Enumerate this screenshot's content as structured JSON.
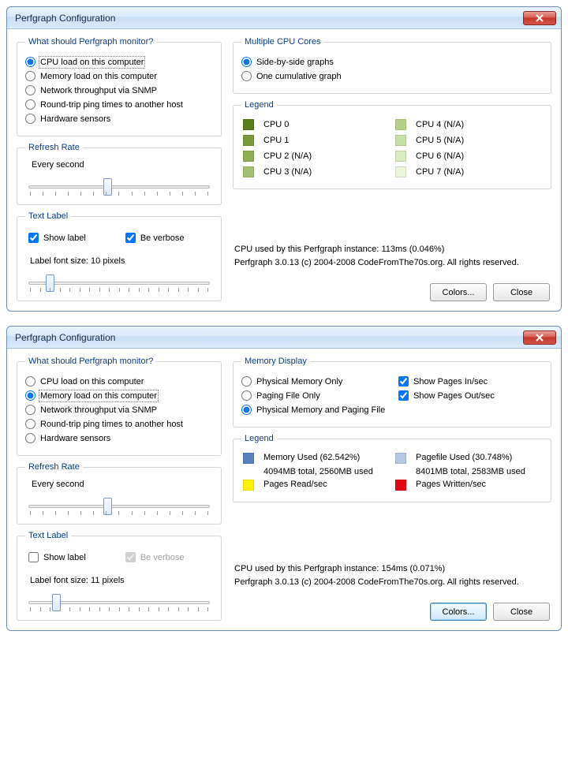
{
  "win1": {
    "title": "Perfgraph Configuration",
    "monitor": {
      "legend": "What should Perfgraph monitor?",
      "opt_cpu": "CPU load on this computer",
      "opt_mem": "Memory load on this computer",
      "opt_net": "Network throughput via SNMP",
      "opt_ping": "Round-trip ping times to another host",
      "opt_hw": "Hardware sensors"
    },
    "refresh": {
      "legend": "Refresh Rate",
      "label": "Every second"
    },
    "textlabel": {
      "legend": "Text Label",
      "show": "Show label",
      "verbose": "Be verbose",
      "font": "Label font size: 10 pixels"
    },
    "cores": {
      "legend": "Multiple CPU Cores",
      "side": "Side-by-side graphs",
      "cumulative": "One cumulative graph"
    },
    "cpu_legend": {
      "legend": "Legend",
      "c0": "CPU 0",
      "c1": "CPU 1",
      "c2": "CPU 2 (N/A)",
      "c3": "CPU 3 (N/A)",
      "c4": "CPU 4 (N/A)",
      "c5": "CPU 5 (N/A)",
      "c6": "CPU 6 (N/A)",
      "c7": "CPU 7 (N/A)",
      "col0": "#5b7c1a",
      "col1": "#7a9a3a",
      "col2": "#8fae54",
      "col3": "#a3c06f",
      "col4": "#b6d08a",
      "col5": "#c8dfa5",
      "col6": "#d9ebc1",
      "col7": "#eaf5dc"
    },
    "status1": "CPU used by this Perfgraph instance: 113ms (0.046%)",
    "status2": "Perfgraph 3.0.13 (c) 2004-2008 CodeFromThe70s.org. All rights reserved.",
    "btn_colors": "Colors...",
    "btn_close": "Close"
  },
  "win2": {
    "title": "Perfgraph Configuration",
    "monitor": {
      "legend": "What should Perfgraph monitor?",
      "opt_cpu": "CPU load on this computer",
      "opt_mem": "Memory load on this computer",
      "opt_net": "Network throughput via SNMP",
      "opt_ping": "Round-trip ping times to another host",
      "opt_hw": "Hardware sensors"
    },
    "refresh": {
      "legend": "Refresh Rate",
      "label": "Every second"
    },
    "textlabel": {
      "legend": "Text Label",
      "show": "Show label",
      "verbose": "Be verbose",
      "font": "Label font size: 11 pixels"
    },
    "memdisp": {
      "legend": "Memory Display",
      "phys": "Physical Memory Only",
      "page": "Paging File Only",
      "both": "Physical Memory and Paging File",
      "pin": "Show Pages In/sec",
      "pout": "Show Pages Out/sec"
    },
    "mem_legend": {
      "legend": "Legend",
      "mu": "Memory Used (62.542%)",
      "mu_sub": "4094MB total, 2560MB used",
      "pu": "Pagefile Used (30.748%)",
      "pu_sub": "8401MB total, 2583MB used",
      "pr": "Pages Read/sec",
      "pw": "Pages Written/sec",
      "col_mu": "#5a7fc1",
      "col_pu": "#b8c8e2",
      "col_pr": "#fff200",
      "col_pw": "#e30613"
    },
    "status1": "CPU used by this Perfgraph instance: 154ms (0.071%)",
    "status2": "Perfgraph 3.0.13 (c) 2004-2008 CodeFromThe70s.org. All rights reserved.",
    "btn_colors": "Colors...",
    "btn_close": "Close"
  }
}
